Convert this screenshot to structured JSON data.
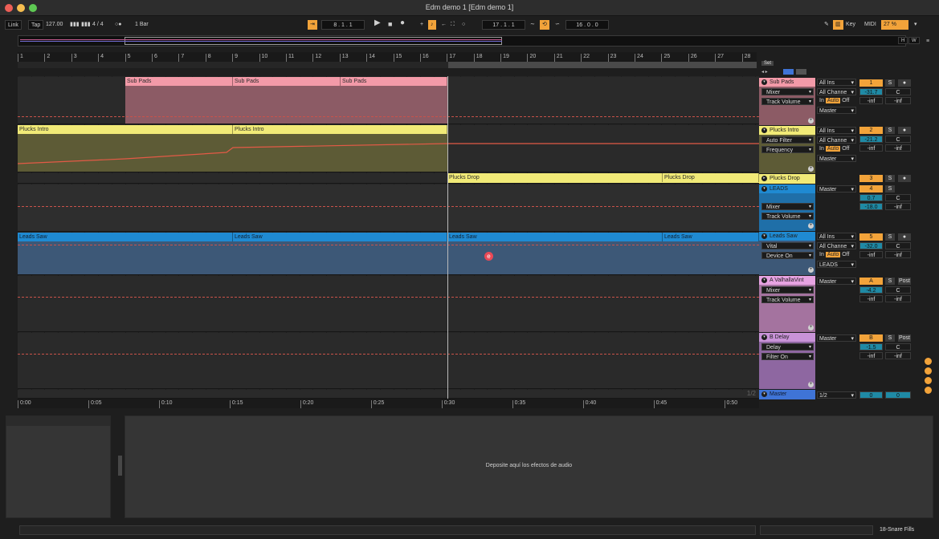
{
  "window": {
    "title": "Edm demo 1  [Edm demo 1]"
  },
  "control_bar": {
    "link": "Link",
    "tap": "Tap",
    "tempo": "127.00",
    "time_sig": "4 / 4",
    "quantize": "1 Bar",
    "position": "8 .  1 .  1",
    "loop_start": "17 .  1 .  1",
    "loop_length": "16 .  0 .  0",
    "key": "Key",
    "midi": "MIDI",
    "cpu": "27 %",
    "h_btn": "H",
    "w_btn": "W"
  },
  "ruler": {
    "bars": [
      "1",
      "2",
      "3",
      "4",
      "5",
      "6",
      "7",
      "8",
      "9",
      "10",
      "11",
      "12",
      "13",
      "14",
      "15",
      "16",
      "17",
      "18",
      "19",
      "20",
      "21",
      "22",
      "23",
      "24",
      "25",
      "26",
      "27",
      "28"
    ],
    "set_label": "Set"
  },
  "timeline": {
    "times": [
      "0:00",
      "0:05",
      "0:10",
      "0:15",
      "0:20",
      "0:25",
      "0:30",
      "0:35",
      "0:40",
      "0:45",
      "0:50"
    ],
    "page": "1/2"
  },
  "colors": {
    "pink": "#f39aa8",
    "yellow": "#f1ea77",
    "blue": "#1f8ad2",
    "lavender": "#e7a3e2",
    "purple": "#c993d8",
    "master_blue": "#3f74d6",
    "accent_orange": "#f2a33a"
  },
  "tracks": [
    {
      "name": "Sub Pads",
      "color": "#f39aa8",
      "clips": [
        "Sub Pads",
        "Sub Pads",
        "Sub Pads"
      ],
      "device": "Mixer",
      "param": "Track Volume",
      "input_type": "All Ins",
      "input_channel": "All Channe",
      "monitor": [
        "In",
        "Auto",
        "Off"
      ],
      "output": "Master",
      "number": "1",
      "solo": "S",
      "volume": "-31.7",
      "pan": "C",
      "send_a": "-inf",
      "send_b": "-inf"
    },
    {
      "name": "Plucks Intro",
      "color": "#f1ea77",
      "clips": [
        "Plucks Intro",
        "Plucks Intro"
      ],
      "device": "Auto Filter",
      "param": "Frequency",
      "input_type": "All Ins",
      "input_channel": "All Channe",
      "monitor": [
        "In",
        "Auto",
        "Off"
      ],
      "output": "Master",
      "number": "2",
      "solo": "S",
      "volume": "-21.2",
      "pan": "C",
      "send_a": "-inf",
      "send_b": "-inf"
    },
    {
      "name": "Plucks Drop",
      "color": "#f1ea77",
      "clips": [
        "Plucks Drop",
        "Plucks Drop"
      ],
      "number": "3",
      "solo": "S"
    },
    {
      "name": "LEADS",
      "color": "#1f8ad2",
      "device": "Mixer",
      "param": "Track Volume",
      "output": "Master",
      "number": "4",
      "solo": "S",
      "volume": "0.7",
      "pan": "C",
      "send_a": "-18.0",
      "send_b": "-inf"
    },
    {
      "name": "Leads Saw",
      "color": "#1f8ad2",
      "clips": [
        "Leads Saw",
        "Leads Saw",
        "Leads Saw",
        "Leads Saw"
      ],
      "device": "Vital",
      "param": "Device On",
      "input_type": "All Ins",
      "input_channel": "All Channe",
      "monitor": [
        "In",
        "Auto",
        "Off"
      ],
      "output": "LEADS",
      "number": "5",
      "solo": "S",
      "volume": "-32.0",
      "pan": "C",
      "send_a": "-inf",
      "send_b": "-inf"
    },
    {
      "name": "A ValhallaVint",
      "color": "#e7a3e2",
      "device": "Mixer",
      "param": "Track Volume",
      "output": "Master",
      "number": "A",
      "solo": "S",
      "post": "Post",
      "volume": "-4.2",
      "pan": "C",
      "send_a": "-inf",
      "send_b": "-inf"
    },
    {
      "name": "B Delay",
      "color": "#c993d8",
      "device": "Delay",
      "param": "Filter On",
      "output": "Master",
      "number": "B",
      "solo": "S",
      "post": "Post",
      "volume": "-1.5",
      "pan": "C",
      "send_a": "-inf",
      "send_b": "-inf"
    },
    {
      "name": "Master",
      "color": "#3f74d6",
      "output": "1/2",
      "volume": "0",
      "pan": "0"
    }
  ],
  "device_panel": {
    "drop_text": "Deposite aquí los efectos de audio"
  },
  "status_bar": {
    "track": "18-Snare Fills"
  }
}
